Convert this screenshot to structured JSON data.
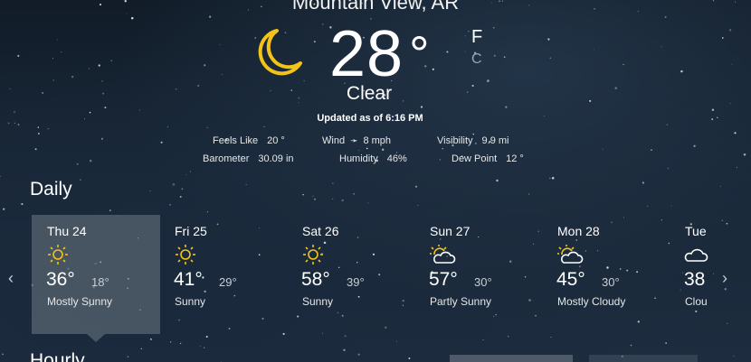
{
  "location": "Mountain View, AR",
  "current": {
    "icon": "moon-icon",
    "temperature": "28",
    "degree": "°",
    "unit_f": "F",
    "unit_c": "C",
    "condition": "Clear",
    "updated": "Updated as of 6:16 PM"
  },
  "details": {
    "feels_like_label": "Feels Like",
    "feels_like": "20 °",
    "wind_label": "Wind",
    "wind": "8 mph",
    "visibility_label": "Visibility",
    "visibility": "9.9 mi",
    "barometer_label": "Barometer",
    "barometer": "30.09 in",
    "humidity_label": "Humidity",
    "humidity": "46%",
    "dew_point_label": "Dew Point",
    "dew_point": "12 °"
  },
  "daily": {
    "title": "Daily",
    "days": [
      {
        "name": "Thu 24",
        "icon": "sun-icon",
        "hi": "36°",
        "lo": "18°",
        "cond": "Mostly Sunny",
        "selected": true
      },
      {
        "name": "Fri 25",
        "icon": "sun-icon",
        "hi": "41°",
        "lo": "29°",
        "cond": "Sunny"
      },
      {
        "name": "Sat 26",
        "icon": "sun-icon",
        "hi": "58°",
        "lo": "39°",
        "cond": "Sunny"
      },
      {
        "name": "Sun 27",
        "icon": "partly-sunny-icon",
        "hi": "57°",
        "lo": "30°",
        "cond": "Partly Sunny"
      },
      {
        "name": "Mon 28",
        "icon": "partly-sunny-icon",
        "hi": "45°",
        "lo": "30°",
        "cond": "Mostly Cloudy"
      },
      {
        "name": "Tue",
        "icon": "cloud-icon",
        "hi": "38",
        "lo": "",
        "cond": "Clou"
      }
    ]
  },
  "hourly": {
    "title": "Hourly"
  },
  "nav": {
    "prev": "‹",
    "next": "›"
  },
  "colors": {
    "sun": "#f2c318",
    "moon": "#f2c318",
    "selected_tile": "#6e7884"
  }
}
